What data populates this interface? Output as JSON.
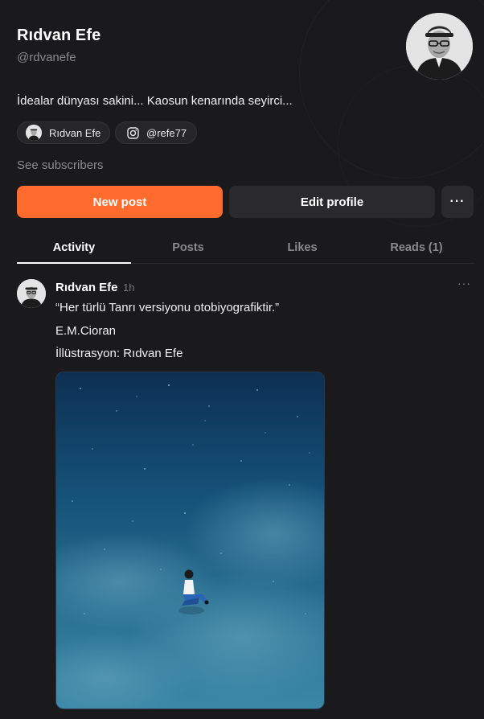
{
  "profile": {
    "name": "Rıdvan Efe",
    "handle": "@rdvanefe",
    "bio": "İdealar dünyası sakini... Kaosun kenarında seyirci...",
    "links": [
      {
        "label": "Rıdvan Efe",
        "icon": "avatar"
      },
      {
        "label": "@refe77",
        "icon": "instagram-icon"
      }
    ],
    "see_subscribers": "See subscribers"
  },
  "actions": {
    "new_post": "New post",
    "edit_profile": "Edit profile",
    "more": "···"
  },
  "tabs": [
    {
      "label": "Activity",
      "active": true
    },
    {
      "label": "Posts",
      "active": false
    },
    {
      "label": "Likes",
      "active": false
    },
    {
      "label": "Reads (1)",
      "active": false
    }
  ],
  "post": {
    "author": "Rıdvan Efe",
    "time": "1h",
    "more": "···",
    "lines": [
      "“Her türlü Tanrı versiyonu otobiyografiktir.”",
      "E.M.Cioran",
      "İllüstrasyon: Rıdvan Efe"
    ]
  },
  "colors": {
    "background": "#1a1a1c",
    "accent": "#ff6b2c",
    "button_secondary": "#2a2a2c"
  }
}
